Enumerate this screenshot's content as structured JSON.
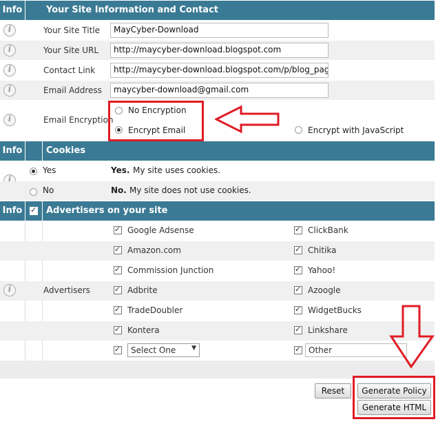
{
  "sections": {
    "site_info": {
      "info_label": "Info",
      "title": "Your Site Information and Contact"
    },
    "cookies": {
      "info_label": "Info",
      "title": "Cookies"
    },
    "advertisers": {
      "info_label": "Info",
      "title": "Advertisers on your site"
    }
  },
  "site_fields": [
    {
      "label": "Your Site Title",
      "value": "MayCyber-Download"
    },
    {
      "label": "Your Site URL",
      "value": "http://maycyber-download.blogspot.com"
    },
    {
      "label": "Contact Link",
      "value": "http://maycyber-download.blogspot.com/p/blog_page_"
    },
    {
      "label": "Email Address",
      "value": "maycyber-download@gmail.com"
    }
  ],
  "encryption": {
    "label": "Email Encryption",
    "options": [
      "No Encryption",
      "Encrypt Email",
      "Encrypt with JavaScript"
    ],
    "selected": "Encrypt Email"
  },
  "cookies": {
    "yes_label": "Yes",
    "yes_bold": "Yes.",
    "yes_desc": "My site uses cookies.",
    "no_label": "No",
    "no_bold": "No.",
    "no_desc": "My site does not use cookies.",
    "selected": "Yes"
  },
  "advertisers": {
    "label": "Advertisers",
    "left": [
      "Google Adsense",
      "Amazon.com",
      "Commission Junction",
      "Adbrite",
      "TradeDoubler",
      "Kontera"
    ],
    "right": [
      "ClickBank",
      "Chitika",
      "Yahoo!",
      "Azoogle",
      "WidgetBucks",
      "Linkshare"
    ],
    "select_value": "Select One",
    "other_value": "Other"
  },
  "buttons": {
    "reset": "Reset",
    "generate_policy": "Generate Policy",
    "generate_html": "Generate HTML"
  },
  "colors": {
    "header_bg": "#3a7a94",
    "highlight": "#e01b24"
  }
}
